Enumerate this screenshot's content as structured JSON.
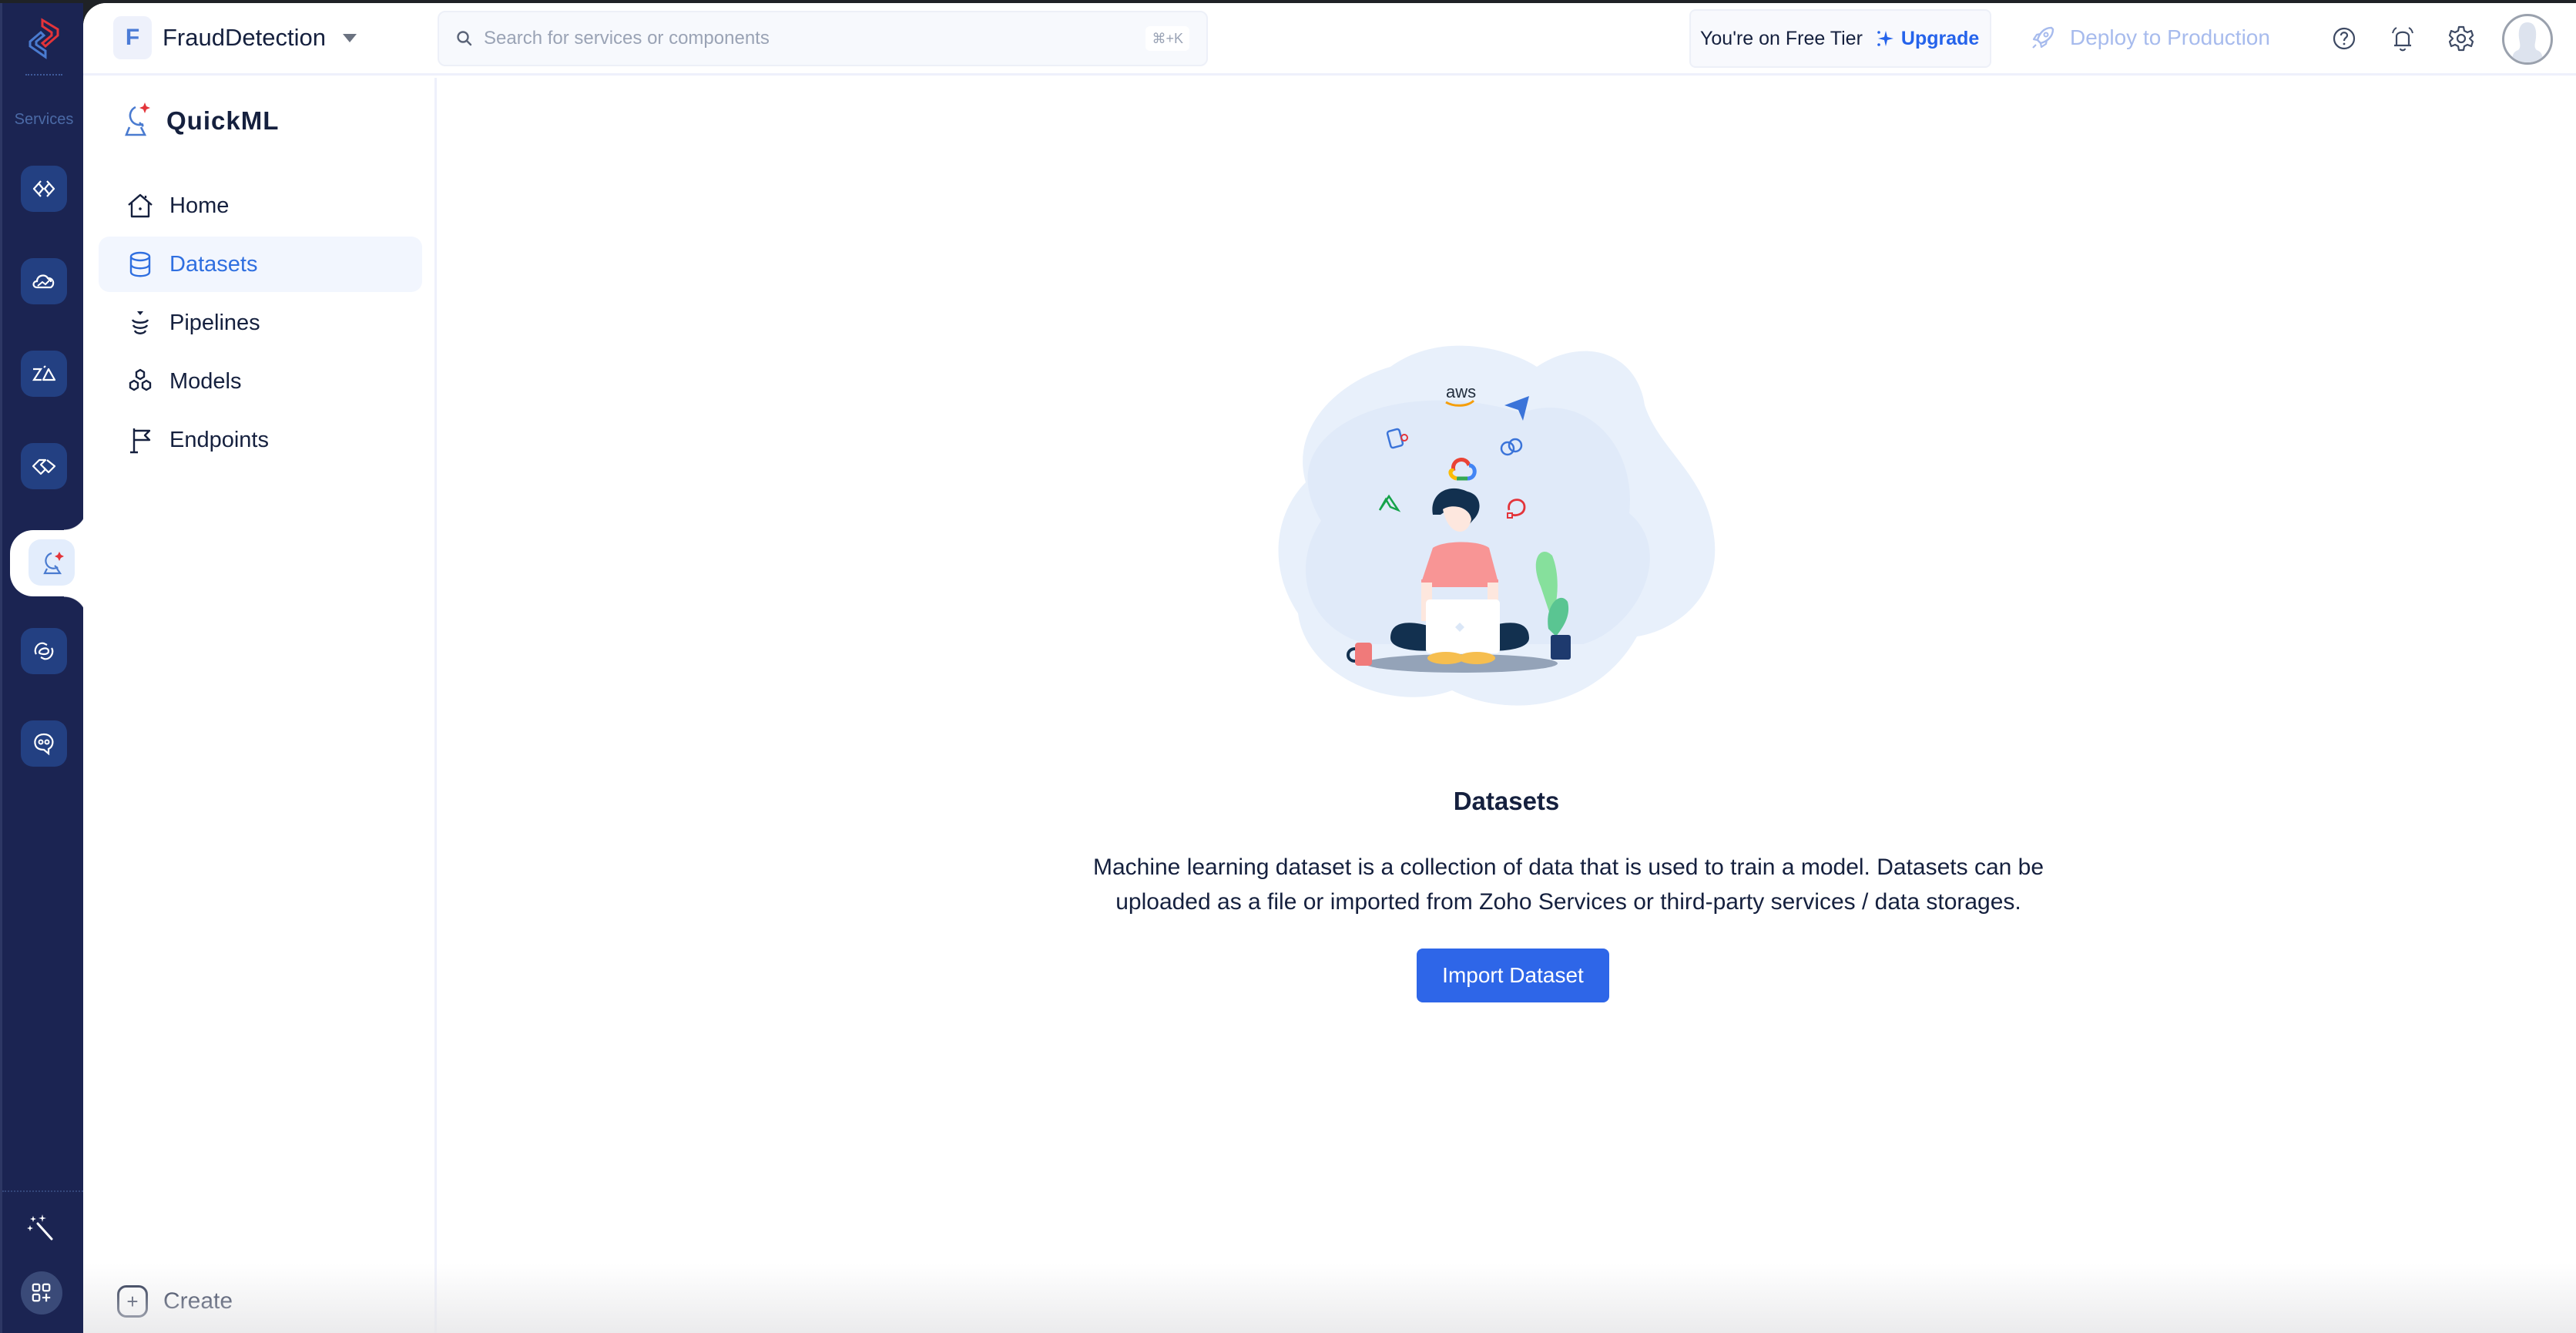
{
  "rail": {
    "services_label": "Services",
    "items": [
      {
        "name": "code-service",
        "icon": "code-brackets-icon"
      },
      {
        "name": "cloud-service",
        "icon": "cloud-chart-icon"
      },
      {
        "name": "zia-service",
        "icon": "zia-icon"
      },
      {
        "name": "integration-service",
        "icon": "handshake-icon"
      },
      {
        "name": "quickml-service",
        "icon": "quickml-icon",
        "active": true
      },
      {
        "name": "link-service",
        "icon": "link-icon"
      },
      {
        "name": "chatbot-service",
        "icon": "chat-bot-icon"
      }
    ],
    "bottom": [
      {
        "name": "magic-wand",
        "icon": "magic-wand-icon"
      },
      {
        "name": "add-apps",
        "icon": "apps-plus-icon"
      }
    ]
  },
  "header": {
    "project_initial": "F",
    "project_name": "FraudDetection",
    "search_placeholder": "Search for services or components",
    "search_shortcut": "⌘+K",
    "tier_text": "You're on Free Tier",
    "upgrade_label": "Upgrade",
    "deploy_label": "Deploy to Production"
  },
  "leftnav": {
    "app_name": "QuickML",
    "items": [
      {
        "label": "Home",
        "icon": "home-icon"
      },
      {
        "label": "Datasets",
        "icon": "database-icon",
        "active": true
      },
      {
        "label": "Pipelines",
        "icon": "pipeline-icon"
      },
      {
        "label": "Models",
        "icon": "models-icon"
      },
      {
        "label": "Endpoints",
        "icon": "flag-icon"
      }
    ],
    "create_label": "Create"
  },
  "main": {
    "title": "Datasets",
    "description": "Machine learning dataset is a collection of data that is used to train a model. Datasets can be uploaded as a file or imported from Zoho Services or third-party services / data storages.",
    "button_label": "Import Dataset",
    "illustration_logos": [
      "aws",
      "google-cloud"
    ]
  },
  "colors": {
    "rail_bg": "#1b2452",
    "accent": "#2e66e8",
    "active_nav_text": "#2f6fe0",
    "upgrade": "#2563eb",
    "deploy_disabled": "#a7bbed"
  }
}
